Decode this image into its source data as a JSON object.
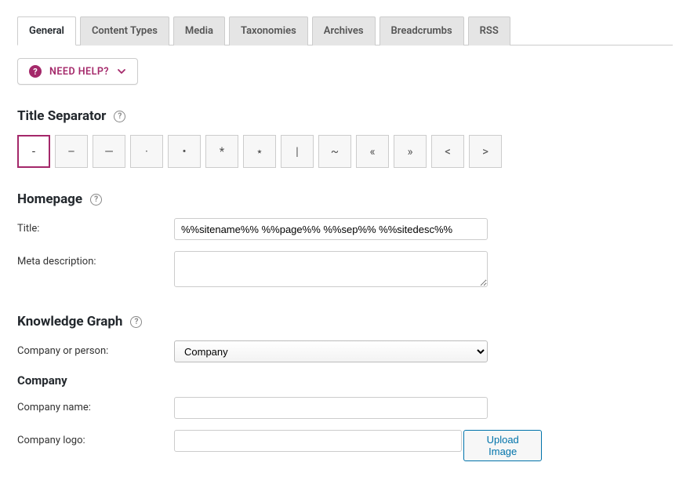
{
  "tabs": [
    {
      "label": "General",
      "active": true
    },
    {
      "label": "Content Types",
      "active": false
    },
    {
      "label": "Media",
      "active": false
    },
    {
      "label": "Taxonomies",
      "active": false
    },
    {
      "label": "Archives",
      "active": false
    },
    {
      "label": "Breadcrumbs",
      "active": false
    },
    {
      "label": "RSS",
      "active": false
    }
  ],
  "help_button": {
    "label": "NEED HELP?"
  },
  "title_separator": {
    "heading": "Title Separator",
    "choices": [
      "-",
      "–",
      "—",
      "·",
      "•",
      "*",
      "⋆",
      "|",
      "~",
      "«",
      "»",
      "<",
      ">"
    ],
    "selected_index": 0
  },
  "homepage": {
    "heading": "Homepage",
    "title_label": "Title:",
    "title_value": "%%sitename%% %%page%% %%sep%% %%sitedesc%%",
    "meta_label": "Meta description:",
    "meta_value": ""
  },
  "knowledge_graph": {
    "heading": "Knowledge Graph",
    "entity_label": "Company or person:",
    "entity_value": "Company",
    "subheading": "Company",
    "company_name_label": "Company name:",
    "company_name_value": "",
    "company_logo_label": "Company logo:",
    "company_logo_value": "",
    "upload_label": "Upload Image"
  }
}
